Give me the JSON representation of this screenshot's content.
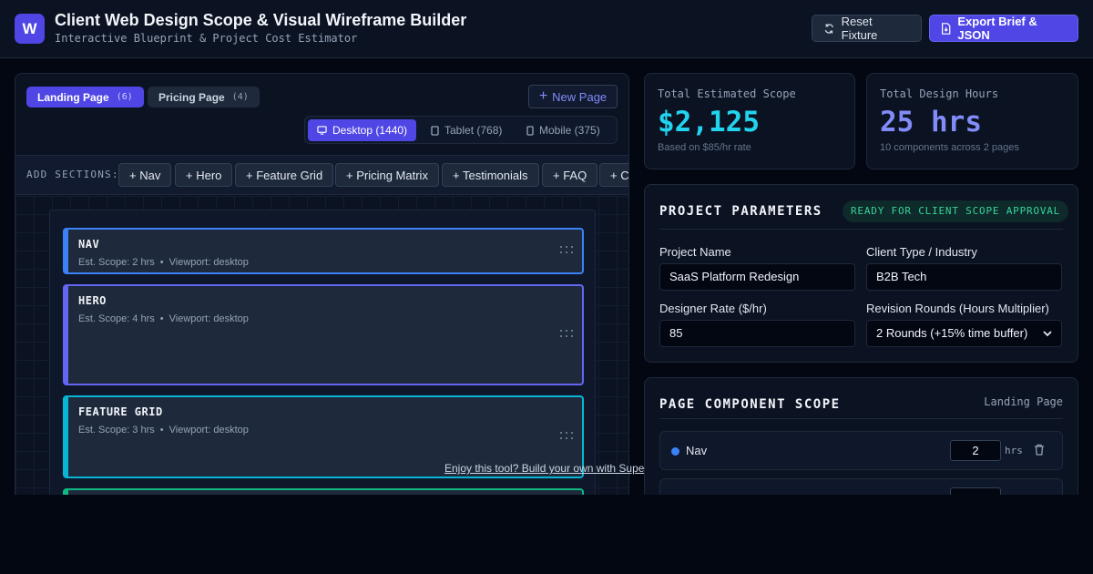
{
  "app": {
    "logo_letter": "W",
    "title": "Client Web Design Scope & Visual Wireframe Builder",
    "subtitle": "Interactive Blueprint & Project Cost Estimator"
  },
  "toolbar": {
    "reset_label": "Reset Fixture",
    "export_label": "Export Brief & JSON"
  },
  "pages": [
    {
      "label": "Landing Page",
      "count": "(6)",
      "active": true
    },
    {
      "label": "Pricing Page",
      "count": "(4)",
      "active": false
    }
  ],
  "new_page_label": "New Page",
  "viewports": [
    {
      "label": "Desktop (1440)",
      "icon": "desktop-icon",
      "active": true
    },
    {
      "label": "Tablet (768)",
      "icon": "tablet-icon",
      "active": false
    },
    {
      "label": "Mobile (375)",
      "icon": "mobile-icon",
      "active": false
    }
  ],
  "add_sections": {
    "label": "ADD SECTIONS:",
    "buttons": [
      "+ Nav",
      "+ Hero",
      "+ Feature Grid",
      "+ Pricing Matrix",
      "+ Testimonials",
      "+ FAQ",
      "+ CTA"
    ]
  },
  "wireframe_blocks": [
    {
      "title": "NAV",
      "scope": "Est. Scope: 2 hrs",
      "viewport": "Viewport: desktop",
      "color": "#3b82f6"
    },
    {
      "title": "HERO",
      "scope": "Est. Scope: 4 hrs",
      "viewport": "Viewport: desktop",
      "color": "#6366f1"
    },
    {
      "title": "FEATURE GRID",
      "scope": "Est. Scope: 3 hrs",
      "viewport": "Viewport: desktop",
      "color": "#06b6d4"
    }
  ],
  "promo_link": "Enjoy this tool? Build your own with Super",
  "stats": {
    "scope": {
      "label": "Total Estimated Scope",
      "value": "$2,125",
      "note": "Based on $85/hr rate",
      "color": "#22d3ee"
    },
    "hours": {
      "label": "Total Design Hours",
      "value": "25 hrs",
      "note": "10 components across 2 pages",
      "color": "#818cf8"
    }
  },
  "params": {
    "title": "PROJECT PARAMETERS",
    "badge": "READY FOR CLIENT SCOPE APPROVAL",
    "project_name_label": "Project Name",
    "project_name_value": "SaaS Platform Redesign",
    "client_type_label": "Client Type / Industry",
    "client_type_value": "B2B Tech",
    "rate_label": "Designer Rate ($/hr)",
    "rate_value": "85",
    "revision_label": "Revision Rounds (Hours Multiplier)",
    "revision_value": "2 Rounds (+15% time buffer)"
  },
  "components": {
    "title": "PAGE COMPONENT SCOPE",
    "page": "Landing Page",
    "unit": "hrs",
    "rows": [
      {
        "name": "Nav",
        "hours": "2",
        "color": "#3b82f6"
      }
    ]
  }
}
